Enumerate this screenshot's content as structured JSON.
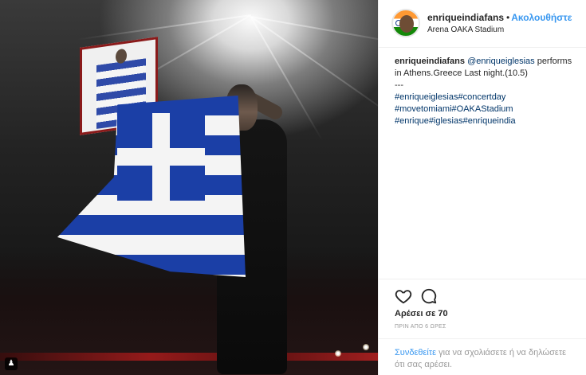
{
  "post": {
    "username": "enriqueindiafans",
    "separator": "•",
    "follow_label": "Ακολουθήστε",
    "location": "Arena OAKA Stadium",
    "caption": {
      "username": "enriqueindiafans",
      "mention": "@enriqueiglesias",
      "text_line1": " performs",
      "text_line2": "in Athens.Greece Last night.(10.5)",
      "divider": "---",
      "hashtag_lines": [
        "#enriqueiglesias#concertday",
        "#movetomiami#OAKAStadium",
        "#enrique#iglesias#enriqueindia"
      ]
    },
    "likes": "Αρέσει σε 70",
    "time_ago": "ΠΡΙΝ ΑΠΟ 6 ΩΡΕΣ",
    "login_link": "Συνδεθείτε",
    "login_text": " για να σχολιάσετε ή να δηλώσετε ότι σας αρέσει."
  },
  "icons": {
    "like": "heart-outline-icon",
    "comment": "speech-bubble-icon",
    "user_tag": "person-tag-icon"
  },
  "colors": {
    "link_blue": "#3897f0",
    "hashtag_blue": "#003569",
    "text": "#262626",
    "muted": "#999999",
    "divider": "#efefef"
  }
}
